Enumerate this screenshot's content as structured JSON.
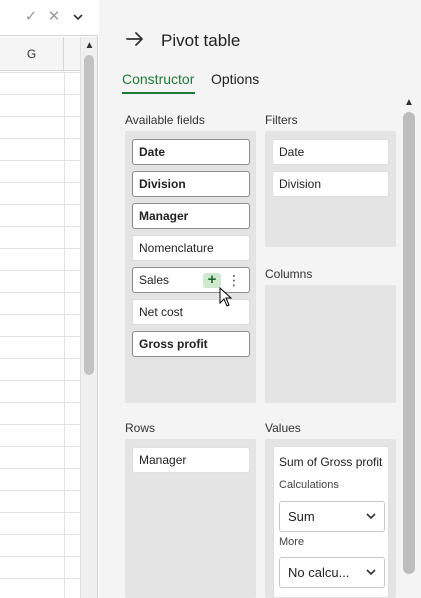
{
  "formula_bar": {
    "confirm_icon": "check-icon",
    "cancel_icon": "x-icon",
    "expand_icon": "chevron-down-icon"
  },
  "sheet": {
    "column_header": "G"
  },
  "panel": {
    "title": "Pivot table",
    "back_icon": "arrow-right-icon",
    "tabs": [
      {
        "label": "Constructor",
        "active": true
      },
      {
        "label": "Options",
        "active": false
      }
    ],
    "sections": {
      "available_fields": "Available fields",
      "filters": "Filters",
      "columns": "Columns",
      "rows": "Rows",
      "values": "Values"
    },
    "available_fields": [
      {
        "label": "Date",
        "bold": true
      },
      {
        "label": "Division",
        "bold": true
      },
      {
        "label": "Manager",
        "bold": true
      },
      {
        "label": "Nomenclature",
        "bold": false
      },
      {
        "label": "Sales",
        "bold": false
      },
      {
        "label": "Net cost",
        "bold": false
      },
      {
        "label": "Gross profit",
        "bold": true
      }
    ],
    "hover_actions": {
      "add": "+",
      "more": "⋮"
    },
    "filters": [
      "Date",
      "Division"
    ],
    "columns": [],
    "rows": [
      "Manager"
    ],
    "values": {
      "field": "Sum of Gross profit",
      "calculations_label": "Calculations",
      "calculation": "Sum",
      "more_label": "More",
      "more_value": "No calcu..."
    }
  },
  "colors": {
    "accent": "#1f7a3a",
    "plus_bg": "#cfe9cf"
  }
}
